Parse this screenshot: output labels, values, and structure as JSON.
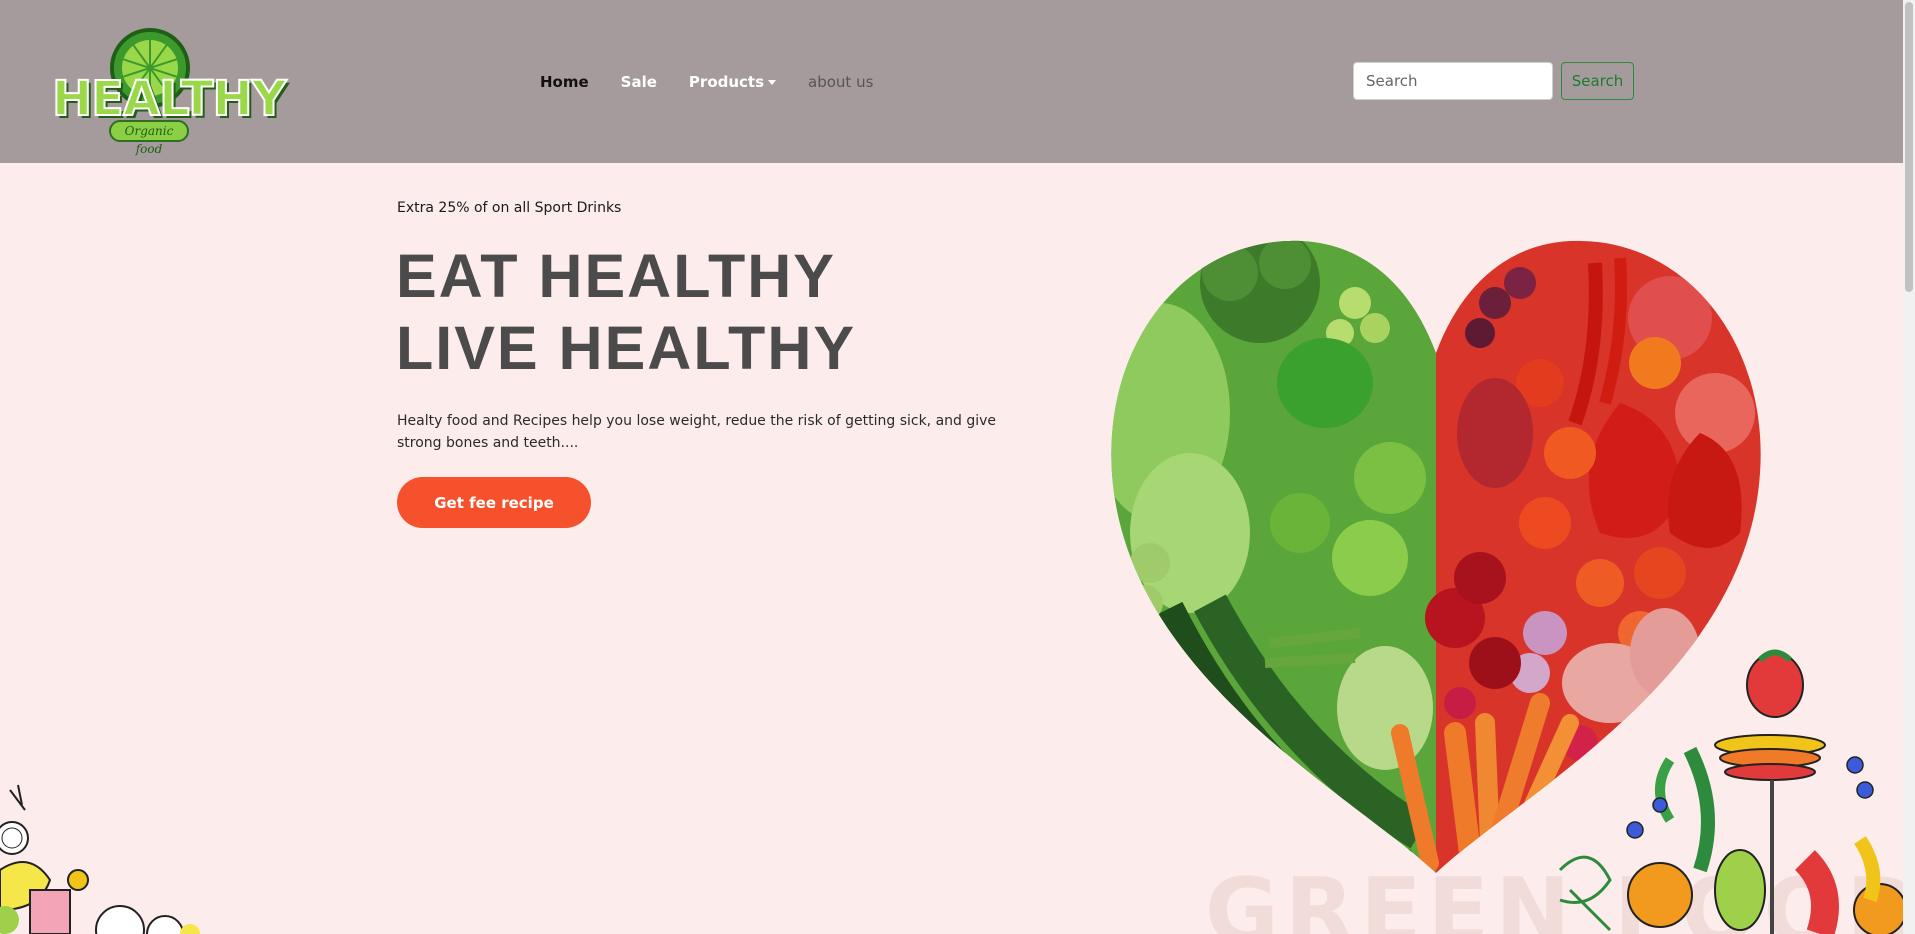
{
  "brand": {
    "logo_word": "HEALTHY",
    "logo_tagline": "Organic food",
    "primary_green": "#9ad84a",
    "dark_green": "#1f5e16"
  },
  "navbar": {
    "background": "#a69b9c",
    "links": {
      "home": "Home",
      "sale": "Sale",
      "products": "Products",
      "about": "about us"
    },
    "search": {
      "placeholder": "Search",
      "value": "",
      "button_label": "Search"
    }
  },
  "hero": {
    "promo": "Extra 25% of on all Sport Drinks",
    "headline_line1": "EAT HEALTHY",
    "headline_line2": "LIVE HEALTHY",
    "description": "Healty food and Recipes help you lose weight, redue the risk of getting sick, and give strong bones and teeth....",
    "cta_label": "Get fee recipe",
    "cta_color": "#f5512c",
    "watermark": "GREEN FOOD"
  },
  "colors": {
    "page_bg": "#fcedec",
    "headline": "#4b4b4b"
  }
}
